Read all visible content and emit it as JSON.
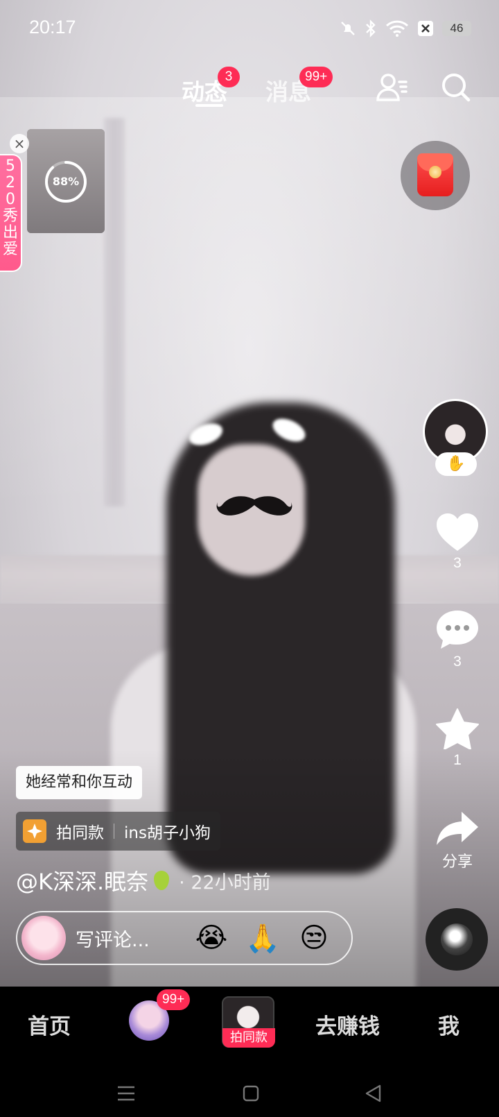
{
  "status_bar": {
    "time": "20:17",
    "battery": "46"
  },
  "top_tabs": [
    {
      "label": "动态",
      "badge": "3",
      "active": true
    },
    {
      "label": "消息",
      "badge": "99+",
      "active": false
    }
  ],
  "pip": {
    "progress_text": "88%",
    "progress": 0.88
  },
  "promo": {
    "text": "520秀出爱"
  },
  "side_actions": {
    "likes": "3",
    "comments": "3",
    "favorites": "1",
    "share_label": "分享"
  },
  "video_info": {
    "interaction_tag": "她经常和你互动",
    "template_action": "拍同款",
    "template_name": "ins胡子小狗",
    "author": "@K深深.眠奈",
    "time_ago": "· 22小时前"
  },
  "comment_bar": {
    "placeholder": "写评论...",
    "emojis": [
      "😭",
      "🙏",
      "😒"
    ]
  },
  "bottom_nav": {
    "home": "首页",
    "friends_badge": "99+",
    "center_label": "拍同款",
    "earn": "去赚钱",
    "me": "我"
  },
  "colors": {
    "accent": "#fe2c55",
    "promo_pink": "#ff6fa0"
  }
}
